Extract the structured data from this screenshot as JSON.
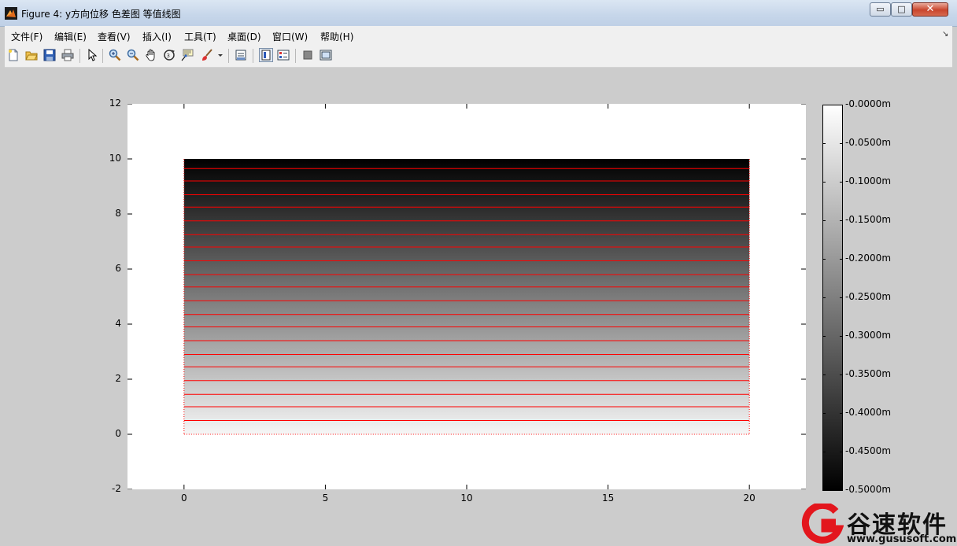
{
  "window": {
    "title": "Figure 4: y方向位移 色差图 等值线图",
    "buttons": {
      "minimize": "▭",
      "maximize": "□",
      "close": "✕"
    }
  },
  "menu": [
    "文件(F)",
    "编辑(E)",
    "查看(V)",
    "插入(I)",
    "工具(T)",
    "桌面(D)",
    "窗口(W)",
    "帮助(H)"
  ],
  "toolbar": [
    {
      "icon": "new-figure-icon"
    },
    {
      "icon": "open-file-icon"
    },
    {
      "icon": "save-icon"
    },
    {
      "icon": "print-icon"
    },
    {
      "icon": "edit-plot-arrow-icon"
    },
    {
      "icon": "zoom-in-icon"
    },
    {
      "icon": "zoom-out-icon"
    },
    {
      "icon": "pan-hand-icon"
    },
    {
      "icon": "rotate-3d-icon"
    },
    {
      "icon": "data-cursor-icon"
    },
    {
      "icon": "brush-icon"
    },
    {
      "icon": "link-plot-icon"
    },
    {
      "icon": "colorbar-icon"
    },
    {
      "icon": "legend-icon"
    },
    {
      "icon": "hide-plot-tools-icon"
    },
    {
      "icon": "show-plot-tools-icon"
    }
  ],
  "chart_data": {
    "type": "heatmap",
    "title": "",
    "xlabel": "",
    "ylabel": "",
    "xlim": [
      -2,
      22
    ],
    "ylim": [
      -2,
      12
    ],
    "x_ticks": [
      "0",
      "5",
      "10",
      "15",
      "20"
    ],
    "y_ticks": [
      "-2",
      "0",
      "2",
      "4",
      "6",
      "8",
      "10",
      "12"
    ],
    "field_region": {
      "x": [
        0,
        20
      ],
      "y": [
        0,
        10
      ]
    },
    "value_at_y_bottom": 0,
    "value_at_y_top": -0.5,
    "colormap": "gray",
    "contour_color": "#ff0000",
    "contour_levels_y": [
      0.5,
      1.0,
      1.45,
      1.95,
      2.45,
      2.9,
      3.4,
      3.9,
      4.35,
      4.85,
      5.35,
      5.8,
      6.3,
      6.8,
      7.25,
      7.75,
      8.25,
      8.7,
      9.2,
      9.65
    ],
    "colorbar": {
      "range": [
        -0.5,
        0
      ],
      "tick_labels": [
        "0.0000m",
        "-0.0500m",
        "-0.1000m",
        "-0.1500m",
        "-0.2000m",
        "-0.2500m",
        "-0.3000m",
        "-0.3500m",
        "-0.4000m",
        "-0.4500m",
        "-0.5000m"
      ]
    }
  },
  "watermark": {
    "name": "谷速软件",
    "url": "www.gususoft.com"
  }
}
